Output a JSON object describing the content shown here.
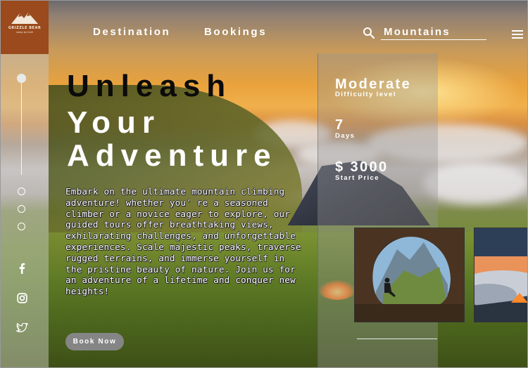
{
  "brand": {
    "name": "GRIZZLE BEAR",
    "tagline": "camp by thrill"
  },
  "nav": {
    "links": [
      "Destination",
      "Bookings"
    ],
    "search_value": "Mountains"
  },
  "hero": {
    "title_line1": "Unleash",
    "title_line2": "Your",
    "title_line3": "Adventure",
    "body": "Embark on the ultimate mountain climbing adventure! whether you' re a seasoned climber or a novice eager to explore, our guided tours offer breathtaking views, exhilarating challenges, and unforgettable experiences. Scale majestic peaks, traverse rugged terrains, and immerse yourself in the pristine beauty of nature. Join us for an adventure of a lifetime and conquer new heights!",
    "cta_label": "Book Now"
  },
  "stats": {
    "difficulty_value": "Moderate",
    "difficulty_label": "Difficulty level",
    "days_value": "7",
    "days_label": "Days",
    "price_value": "$ 3000",
    "price_label": "Start Price"
  },
  "icons": {
    "logo": "mountain-logo-icon",
    "search": "search-icon",
    "menu": "hamburger-menu-icon",
    "social": [
      "facebook-icon",
      "instagram-icon",
      "twitter-icon"
    ]
  },
  "colors": {
    "brand": "#9a4a1c",
    "sidebar": "#c8c8c8",
    "cta": "#858585",
    "hero_dark": "#0b0b0b",
    "hero_light": "#ffffff"
  }
}
